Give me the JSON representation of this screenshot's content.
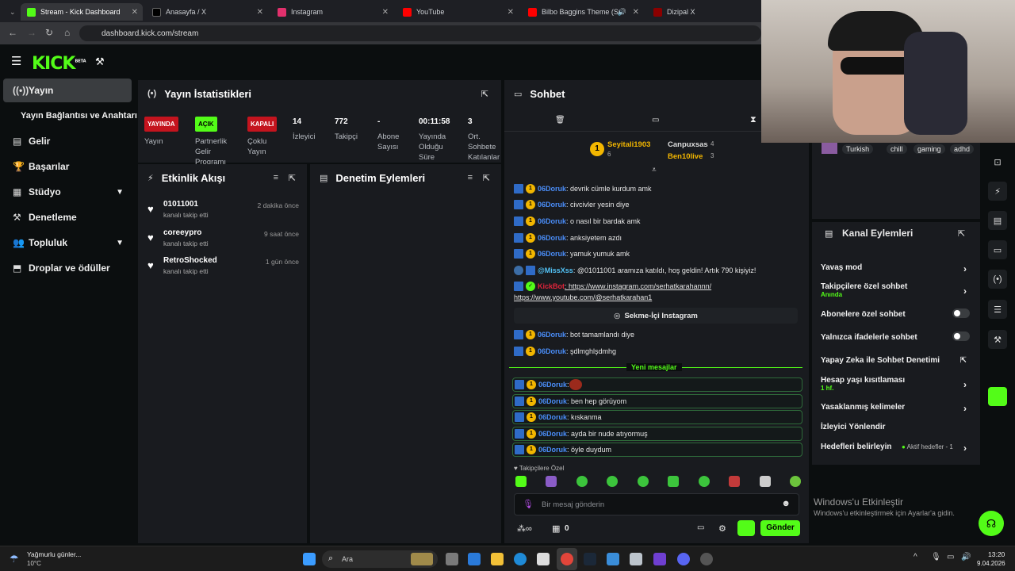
{
  "browser": {
    "tabs": [
      {
        "label": "Stream - Kick Dashboard",
        "color": "#53fc18"
      },
      {
        "label": "Anasayfa / X",
        "color": "#ffffff"
      },
      {
        "label": "Instagram",
        "color": "#e1306c"
      },
      {
        "label": "YouTube",
        "color": "#ff0000"
      },
      {
        "label": "Bilbo Baggins Theme (Suite",
        "color": "#ff0000"
      },
      {
        "label": "Dizipal X",
        "color": "#8b0000"
      }
    ],
    "url": "dashboard.kick.com/stream"
  },
  "kick": {
    "logo": "KICK",
    "logo_sup": "BETA",
    "accent": "#53fc18"
  },
  "sidebar": {
    "items": [
      {
        "label": "Yayın",
        "icon": "broadcast-icon"
      },
      {
        "label": "Yayın Bağlantısı ve Anahtarı",
        "icon": ""
      },
      {
        "label": "Gelir",
        "icon": "revenue-icon"
      },
      {
        "label": "Başarılar",
        "icon": "trophy-icon"
      },
      {
        "label": "Stüdyo",
        "icon": "studio-icon"
      },
      {
        "label": "Denetleme",
        "icon": "hammer-icon"
      },
      {
        "label": "Topluluk",
        "icon": "community-icon"
      },
      {
        "label": "Droplar ve ödüller",
        "icon": "drops-icon"
      }
    ]
  },
  "stats": {
    "title": "Yayın İstatistikleri",
    "items": [
      {
        "pill": "YAYINDA",
        "label": "Yayın"
      },
      {
        "pill": "AÇIK",
        "label": "Partnerlik Gelir Programı"
      },
      {
        "pill": "KAPALI",
        "label": "Çoklu Yayın"
      },
      {
        "value": "14",
        "label": "İzleyici"
      },
      {
        "value": "772",
        "label": "Takipçi"
      },
      {
        "value": "-",
        "label": "Abone Sayısı"
      },
      {
        "value": "00:11:58",
        "label": "Yayında Olduğu Süre"
      },
      {
        "value": "3",
        "label": "Ort. Sohbete Katılanlar"
      }
    ]
  },
  "activity": {
    "title": "Etkinlik Akışı",
    "events": [
      {
        "name": "01011001",
        "sub": "kanalı takip etti",
        "time": "2 dakika önce"
      },
      {
        "name": "coreeypro",
        "sub": "kanalı takip etti",
        "time": "9 saat önce"
      },
      {
        "name": "RetroShocked",
        "sub": "kanalı takip etti",
        "time": "1 gün önce"
      }
    ]
  },
  "moderation": {
    "title": "Denetim Eylemleri"
  },
  "chat": {
    "title": "Sohbet",
    "top_gifters": [
      {
        "name": "Seyitali1903",
        "count": "6"
      },
      {
        "name": "Canpuxsas",
        "count": "4"
      },
      {
        "name": "Ben10live",
        "count": "3"
      }
    ],
    "messages": [
      {
        "user": "06Doruk",
        "text": ": devrik cümle kurdum amk"
      },
      {
        "user": "06Doruk",
        "text": ": civcivler yesin diye"
      },
      {
        "user": "06Doruk",
        "text": ": o nasıl bir bardak amk"
      },
      {
        "user": "06Doruk",
        "text": ": anksiyetem azdı"
      },
      {
        "user": "06Doruk",
        "text": ": yamuk yumuk amk"
      },
      {
        "user": "@MissXss",
        "text": ": @01011001 aramıza katıldı, hoş geldin! Artık 790 kişiyiz!"
      },
      {
        "user": "KickBot",
        "text": ": https://www.instagram.com/serhatkarahannn/"
      },
      {
        "user": "",
        "text": "https://www.youtube.com/@serhatkarahan1"
      }
    ],
    "instagram_button": "Sekme-İçi Instagram",
    "messages2": [
      {
        "user": "06Doruk",
        "text": ": bot tamamlandı diye"
      },
      {
        "user": "06Doruk",
        "text": ": şdlmghlşdmhg"
      }
    ],
    "new_messages": "Yeni mesajlar",
    "messages3": [
      {
        "user": "06Doruk",
        "text": ": "
      },
      {
        "user": "06Doruk",
        "text": ": ben hep görüyom"
      },
      {
        "user": "06Doruk",
        "text": ": kıskanma"
      },
      {
        "user": "06Doruk",
        "text": ": ayda bir nude atıyormuş"
      },
      {
        "user": "06Doruk",
        "text": ": öyle duydum"
      }
    ],
    "followers_only": "Takipçilere Özel",
    "input_placeholder": "Bir mesaj gönderin",
    "points": "0",
    "send_label": "Gönder"
  },
  "tags": [
    "Turkish",
    "chill",
    "gaming",
    "adhd"
  ],
  "channel_actions": {
    "title": "Kanal Eylemleri",
    "rows": [
      {
        "label": "Yavaş mod",
        "sub": ""
      },
      {
        "label": "Takipçilere özel sohbet",
        "sub": "Anında"
      },
      {
        "label": "Abonelere özel sohbet",
        "sub": ""
      },
      {
        "label": "Yalnızca ifadelerle sohbet",
        "sub": ""
      },
      {
        "label": "Yapay Zeka ile Sohbet Denetimi",
        "sub": ""
      },
      {
        "label": "Hesap yaşı kısıtlaması",
        "sub": "1 hf."
      },
      {
        "label": "Yasaklanmış kelimeler",
        "sub": ""
      },
      {
        "label": "İzleyici Yönlendir",
        "sub": ""
      },
      {
        "label": "Hedefleri belirleyin",
        "sub": ""
      }
    ],
    "goals_status": "Aktif hedefler - 1"
  },
  "windows_watermark": {
    "title": "Windows'u Etkinleştir",
    "sub": "Windows'u etkinleştirmek için Ayarlar'a gidin."
  },
  "taskbar": {
    "weather_title": "Yağmurlu günler...",
    "weather_temp": "10°C",
    "search": "Ara",
    "time": "13:20",
    "date": "9.04.2026"
  }
}
